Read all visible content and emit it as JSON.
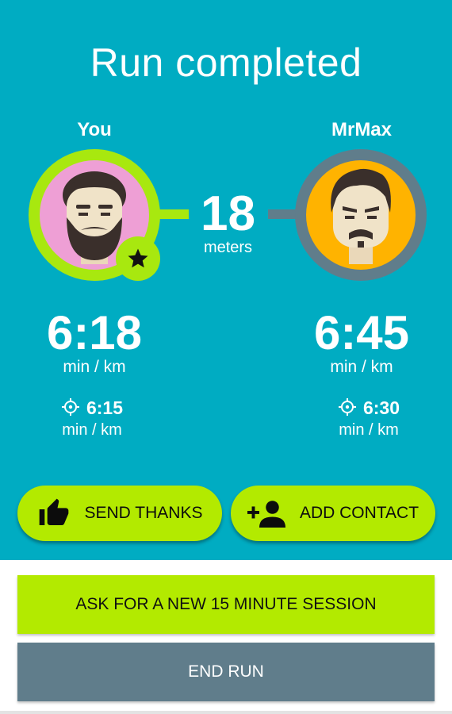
{
  "header": {
    "title": "Run completed"
  },
  "runners": [
    {
      "name": "You",
      "pace": "6:18",
      "pace_unit": "min / km",
      "target_pace": "6:15",
      "target_unit": "min / km",
      "avatar_bg": "#ee9fd5",
      "ring_color": "#a8e80f"
    },
    {
      "name": "MrMax",
      "pace": "6:45",
      "pace_unit": "min / km",
      "target_pace": "6:30",
      "target_unit": "min / km",
      "avatar_bg": "#ffb300",
      "ring_color": "#607d8b"
    }
  ],
  "distance": {
    "value": "18",
    "unit": "meters"
  },
  "actions": {
    "send_thanks": "SEND THANKS",
    "add_contact": "ADD CONTACT",
    "new_session": "ASK FOR A NEW 15 MINUTE SESSION",
    "end_run": "END RUN"
  },
  "icons": {
    "winner_badge": "star-icon",
    "target": "crosshair-icon",
    "thanks": "thumbs-up-icon",
    "contact": "add-person-icon"
  },
  "colors": {
    "background": "#00acc2",
    "accent": "#b3ea00",
    "end_button": "#607d8b"
  }
}
